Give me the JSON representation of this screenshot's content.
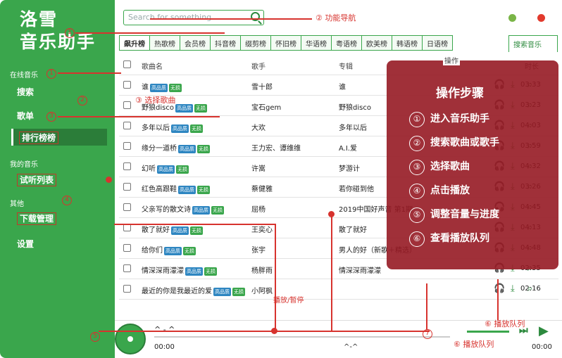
{
  "app": {
    "title_line1": "洛雪",
    "title_line2": "音乐助手"
  },
  "sidebar": {
    "section_online": "在线音乐",
    "search": "搜索",
    "playlist": "歌单",
    "ranking": "排行榜榜",
    "section_mine": "我的音乐",
    "trial_list": "试听列表",
    "section_other": "其他",
    "download": "下载管理",
    "settings": "设置"
  },
  "search": {
    "placeholder": "Search for something..."
  },
  "window_dots": {
    "green": "#7ab547",
    "red": "#e23a2d"
  },
  "tabs": [
    "飙升榜",
    "热歌榜",
    "会员榜",
    "抖音榜",
    "缀剪榜",
    "怀旧榜",
    "华语榜",
    "粤语榜",
    "欧美榜",
    "韩语榜",
    "日语榜"
  ],
  "search_tab": "搜索音乐",
  "table": {
    "headers": {
      "name": "歌曲名",
      "artist": "歌手",
      "album": "专辑",
      "ops": "操作",
      "duration": "时长"
    },
    "rows": [
      {
        "name": "谁",
        "badges": [
          "高品质",
          "无损"
        ],
        "artist": "雪十郎",
        "album": "谁",
        "duration": "03:33"
      },
      {
        "name": "野狼disco",
        "badges": [
          "高品质",
          "无损"
        ],
        "artist": "宝石gem",
        "album": "野狼disco",
        "duration": "03:23"
      },
      {
        "name": "多年以后",
        "badges": [
          "高品质",
          "无损"
        ],
        "artist": "大欢",
        "album": "多年以后",
        "duration": "04:03"
      },
      {
        "name": "缘分一道桥",
        "badges": [
          "高品质",
          "无损"
        ],
        "artist": "王力宏、谭维维",
        "album": "A.I.爱",
        "duration": "03:59"
      },
      {
        "name": "幻听",
        "badges": [
          "高品质",
          "无损"
        ],
        "artist": "许嵩",
        "album": "梦游计",
        "duration": "04:32"
      },
      {
        "name": "红色高跟鞋",
        "badges": [
          "高品质",
          "无损"
        ],
        "artist": "蔡健雅",
        "album": "若你碰到他",
        "duration": "03:26"
      },
      {
        "name": "父亲写的散文诗",
        "badges": [
          "高品质",
          "无损"
        ],
        "artist": "屈杨",
        "album": "2019中国好声音 第1期",
        "duration": "04:45"
      },
      {
        "name": "散了就好",
        "badges": [
          "高品质",
          "无损"
        ],
        "artist": "王奕心",
        "album": "散了就好",
        "duration": "04:13"
      },
      {
        "name": "给你们",
        "badges": [
          "高品质",
          "无损"
        ],
        "artist": "张宇",
        "album": "男人的好（新歌＋精选）",
        "duration": "04:48"
      },
      {
        "name": "情深深雨濛濛",
        "badges": [
          "高品质",
          "无损"
        ],
        "artist": "杨胖雨",
        "album": "情深深雨濛濛",
        "duration": "02:35"
      },
      {
        "name": "最近的你是我最近的爱",
        "badges": [
          "高品质",
          "无损"
        ],
        "artist": "小阿枫",
        "album": "",
        "duration": "02:16"
      }
    ]
  },
  "overlay": {
    "title": "操作步骤",
    "items": [
      "进入音乐助手",
      "搜索歌曲或歌手",
      "选择歌曲",
      "点击播放",
      "调整音量与进度",
      "查看播放队列"
    ],
    "nums": [
      "①",
      "②",
      "③",
      "④",
      "⑤",
      "⑥"
    ]
  },
  "player": {
    "song": "^ - ^",
    "time_left": "00:00",
    "time_mid": "^-^",
    "time_right": "00:00"
  },
  "callouts": {
    "c1": "①",
    "c2": "② 功能导航",
    "c3": "③ 选择歌曲",
    "play_pause": "播放/暂停",
    "queue1": "⑥ 播放队列",
    "queue2": "⑥ 播放队列",
    "n1": "1",
    "n2": "2",
    "n3": "3",
    "n4": "4",
    "n5": "5",
    "n7": "7"
  }
}
